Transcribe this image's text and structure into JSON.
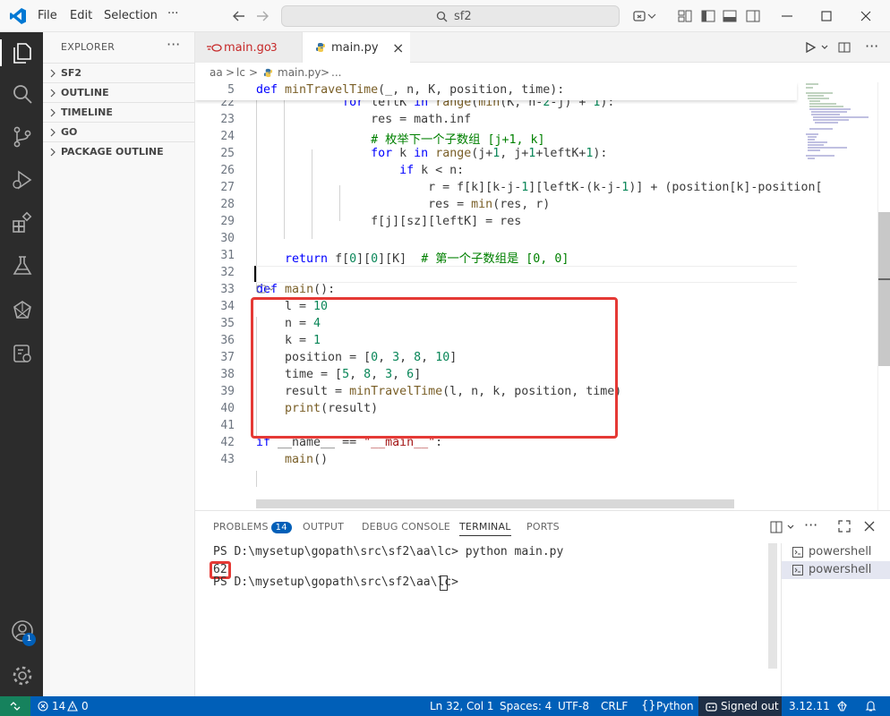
{
  "titlebar": {
    "menu": [
      "File",
      "Edit",
      "Selection"
    ],
    "more": "···",
    "search": "sf2"
  },
  "sidebar": {
    "title": "EXPLORER",
    "more": "···",
    "sections": [
      "SF2",
      "OUTLINE",
      "TIMELINE",
      "GO",
      "PACKAGE OUTLINE"
    ]
  },
  "tabs": [
    {
      "name": "main.go",
      "badge": "3"
    },
    {
      "name": "main.py",
      "close": "×"
    }
  ],
  "breadcrumb": [
    "aa",
    ">",
    "lc",
    ">",
    "main.py",
    ">",
    "..."
  ],
  "editor": {
    "sticky": {
      "line": "5",
      "code": "def minTravelTime(_, n, K, position, time):"
    },
    "lines": [
      {
        "n": "22",
        "code": "            for leftK in range(min(K, n-2-j) + 1):"
      },
      {
        "n": "23",
        "code": "                res = math.inf"
      },
      {
        "n": "24",
        "code": "                # 枚举下一个子数组 [j+1, k]"
      },
      {
        "n": "25",
        "code": "                for k in range(j+1, j+1+leftK+1):"
      },
      {
        "n": "26",
        "code": "                    if k < n:"
      },
      {
        "n": "27",
        "code": "                        r = f[k][k-j-1][leftK-(k-j-1)] + (position[k]-position["
      },
      {
        "n": "28",
        "code": "                        res = min(res, r)"
      },
      {
        "n": "29",
        "code": "                f[j][sz][leftK] = res"
      },
      {
        "n": "30",
        "code": ""
      },
      {
        "n": "31",
        "code": "    return f[0][0][K]  # 第一个子数组是 [0, 0]"
      },
      {
        "n": "32",
        "code": ""
      },
      {
        "n": "33",
        "code": "def main():"
      },
      {
        "n": "34",
        "code": "    l = 10"
      },
      {
        "n": "35",
        "code": "    n = 4"
      },
      {
        "n": "36",
        "code": "    k = 1"
      },
      {
        "n": "37",
        "code": "    position = [0, 3, 8, 10]"
      },
      {
        "n": "38",
        "code": "    time = [5, 8, 3, 6]"
      },
      {
        "n": "39",
        "code": "    result = minTravelTime(l, n, k, position, time)"
      },
      {
        "n": "40",
        "code": "    print(result)"
      },
      {
        "n": "41",
        "code": ""
      },
      {
        "n": "42",
        "code": "if __name__ == \"__main__\":"
      },
      {
        "n": "43",
        "code": "    main()"
      }
    ]
  },
  "panel": {
    "tabs": [
      {
        "label": "PROBLEMS",
        "badge": "14"
      },
      {
        "label": "OUTPUT"
      },
      {
        "label": "DEBUG CONSOLE"
      },
      {
        "label": "TERMINAL"
      },
      {
        "label": "PORTS"
      }
    ],
    "more": "···",
    "terminal": [
      "PS D:\\mysetup\\gopath\\src\\sf2\\aa\\lc> python main.py",
      "62",
      "PS D:\\mysetup\\gopath\\src\\sf2\\aa\\lc> "
    ],
    "terminals": [
      "powershell",
      "powershell"
    ]
  },
  "statusbar": {
    "errors": "14",
    "warnings": "0",
    "position": "Ln 32, Col 1",
    "spaces": "Spaces: 4",
    "encoding": "UTF-8",
    "eol": "CRLF",
    "language": "Python",
    "account": "Signed out",
    "version": "3.12.11"
  },
  "accounts_badge": "1",
  "colors": {
    "accent": "#005fb8",
    "highlight": "#e53935",
    "remote": "#16825d",
    "activitybar": "#2c2c2c"
  }
}
